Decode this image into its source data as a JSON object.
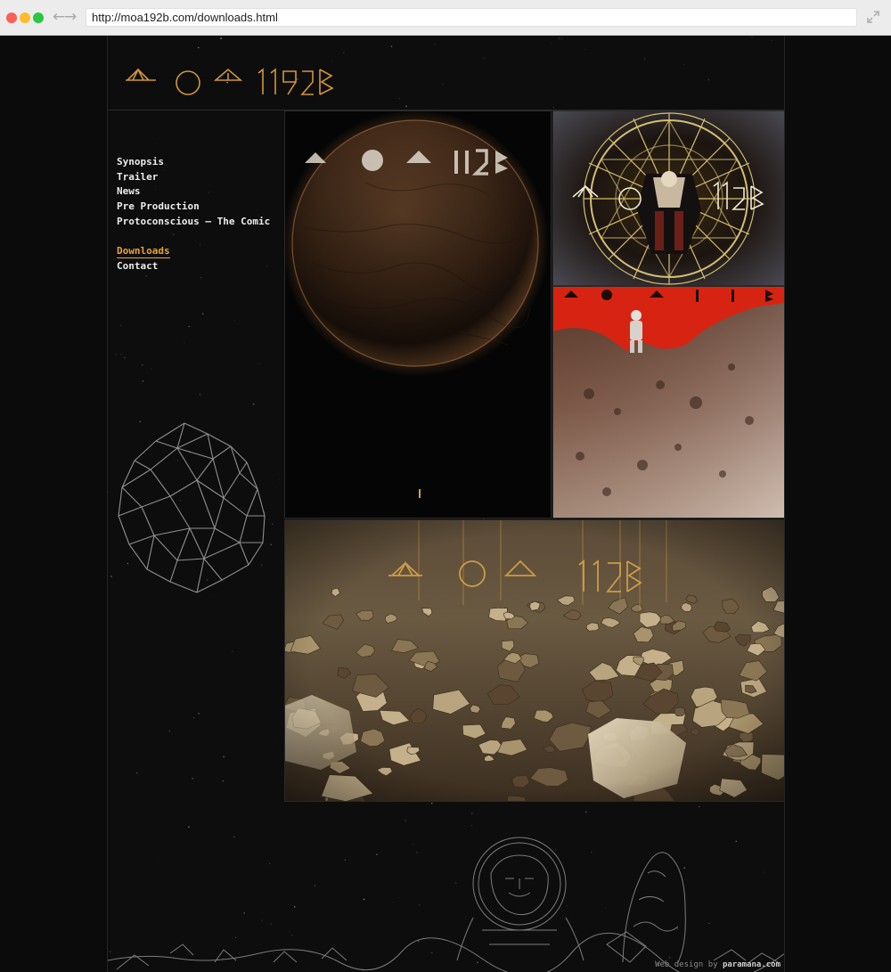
{
  "browser": {
    "url": "http://moa192b.com/downloads.html",
    "back_glyph": "←",
    "forward_glyph": "→"
  },
  "site": {
    "logo_alt_text": "MOA192B",
    "accent_color": "#e8a33a",
    "nav": {
      "items": [
        {
          "label": "Synopsis"
        },
        {
          "label": "Trailer"
        },
        {
          "label": "News"
        },
        {
          "label": "Pre Production"
        },
        {
          "label": "Protoconscious — The Comic"
        },
        {
          "label": "Downloads",
          "active": true
        },
        {
          "label": "Contact"
        }
      ]
    },
    "downloads": [
      {
        "name": "planet-poster"
      },
      {
        "name": "portal-poster"
      },
      {
        "name": "astronaut-poster"
      },
      {
        "name": "rocky-landscape-wallpaper"
      }
    ],
    "footer": {
      "credit_prefix": "Web design by",
      "credit_link": "paramana.com"
    }
  }
}
